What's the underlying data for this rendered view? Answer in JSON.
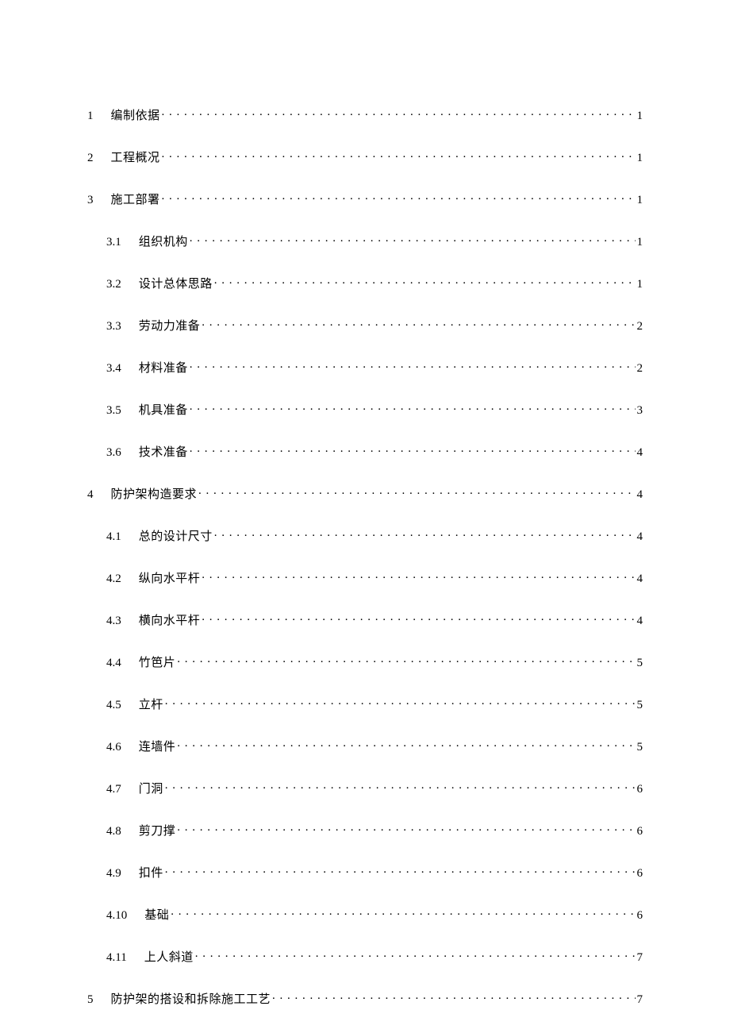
{
  "toc": [
    {
      "level": 1,
      "num": "1",
      "title": "编制依据",
      "page": "1"
    },
    {
      "level": 1,
      "num": "2",
      "title": "工程概况",
      "page": "1"
    },
    {
      "level": 1,
      "num": "3",
      "title": "施工部署",
      "page": "1"
    },
    {
      "level": 2,
      "num": "3.1",
      "title": "组织机构",
      "page": "1"
    },
    {
      "level": 2,
      "num": "3.2",
      "title": "设计总体思路",
      "page": "1"
    },
    {
      "level": 2,
      "num": "3.3",
      "title": "劳动力准备",
      "page": "2"
    },
    {
      "level": 2,
      "num": "3.4",
      "title": "材料准备",
      "page": "2"
    },
    {
      "level": 2,
      "num": "3.5",
      "title": "机具准备",
      "page": "3"
    },
    {
      "level": 2,
      "num": "3.6",
      "title": "技术准备",
      "page": "4"
    },
    {
      "level": 1,
      "num": "4",
      "title": "防护架构造要求",
      "page": "4"
    },
    {
      "level": 2,
      "num": "4.1",
      "title": "总的设计尺寸",
      "page": "4"
    },
    {
      "level": 2,
      "num": "4.2",
      "title": "纵向水平杆",
      "page": "4"
    },
    {
      "level": 2,
      "num": "4.3",
      "title": "横向水平杆",
      "page": "4"
    },
    {
      "level": 2,
      "num": "4.4",
      "title": "竹笆片",
      "page": "5"
    },
    {
      "level": 2,
      "num": "4.5",
      "title": "立杆",
      "page": "5"
    },
    {
      "level": 2,
      "num": "4.6",
      "title": "连墙件",
      "page": "5"
    },
    {
      "level": 2,
      "num": "4.7",
      "title": "门洞",
      "page": "6"
    },
    {
      "level": 2,
      "num": "4.8",
      "title": "剪刀撑",
      "page": "6"
    },
    {
      "level": 2,
      "num": "4.9",
      "title": "扣件",
      "page": "6"
    },
    {
      "level": 2,
      "num": "4.10",
      "title": "基础",
      "page": "6"
    },
    {
      "level": 2,
      "num": "4.11",
      "title": "上人斜道",
      "page": "7"
    },
    {
      "level": 1,
      "num": "5",
      "title": "防护架的搭设和拆除施工工艺",
      "page": "7"
    }
  ]
}
